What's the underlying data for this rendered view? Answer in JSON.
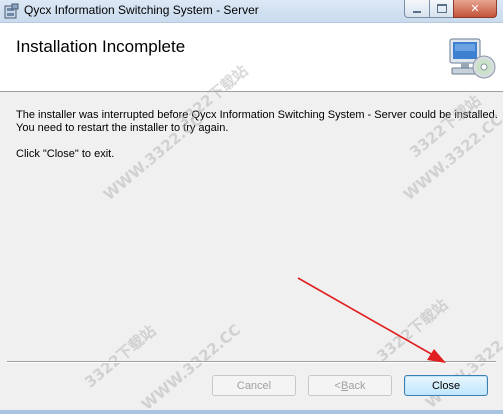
{
  "window": {
    "title": "Qycx Information Switching System - Server",
    "controls": {
      "minimize": "minimize",
      "maximize": "maximize",
      "close": "✕"
    }
  },
  "banner": {
    "title": "Installation Incomplete",
    "icon": "computer-cd-icon"
  },
  "body": {
    "line1": "The installer was interrupted before Qycx Information Switching System - Server could be installed.",
    "line2": "You need to restart the installer to try again.",
    "line3": "Click \"Close\" to exit."
  },
  "buttons": {
    "cancel": "Cancel",
    "back_prefix": "< ",
    "back_accel": "B",
    "back_rest": "ack",
    "close": "Close"
  },
  "watermarks": [
    "3322下载站",
    "WWW.3322.CC",
    "3322下载站",
    "WWW.3322.CC",
    "3322下载站",
    "WWW.3322.CC",
    "3322下载站",
    "WWW.3322.CC"
  ],
  "colors": {
    "arrow": "#e02020",
    "primary_button_border": "#3c7fb1"
  }
}
